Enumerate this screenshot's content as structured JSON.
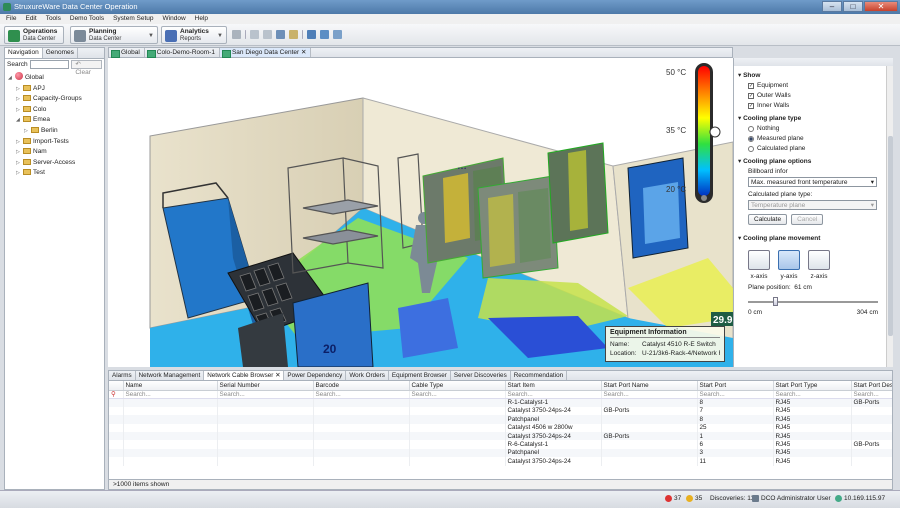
{
  "window": {
    "title": "StruxureWare Data Center Operation",
    "controls": [
      "–",
      "□",
      "✕"
    ]
  },
  "menu": [
    "File",
    "Edit",
    "Tools",
    "Demo Tools",
    "System Setup",
    "Window",
    "Help"
  ],
  "perspectives": [
    {
      "title": "Operations",
      "subtitle": "Data Center",
      "color": "#2f8f4e"
    },
    {
      "title": "Planning",
      "subtitle": "Data Center",
      "color": "#7b8a99"
    },
    {
      "title": "Analytics",
      "subtitle": "Reports",
      "color": "#4a6fb5"
    }
  ],
  "navigation": {
    "tabs": [
      "Navigation",
      "Genomes"
    ],
    "search_label": "Search",
    "search_value": "",
    "clear_label": "Clear",
    "tree": [
      {
        "label": "Global",
        "level": 0,
        "expanded": true,
        "type": "globe"
      },
      {
        "label": "APJ",
        "level": 1,
        "expanded": false,
        "type": "folder"
      },
      {
        "label": "Capacity-Groups",
        "level": 1,
        "expanded": false,
        "type": "folder"
      },
      {
        "label": "Colo",
        "level": 1,
        "expanded": false,
        "type": "folder"
      },
      {
        "label": "Emea",
        "level": 1,
        "expanded": true,
        "type": "folder"
      },
      {
        "label": "Berlin",
        "level": 2,
        "expanded": false,
        "type": "folder"
      },
      {
        "label": "Import-Tests",
        "level": 1,
        "expanded": false,
        "type": "folder"
      },
      {
        "label": "Nam",
        "level": 1,
        "expanded": false,
        "type": "folder"
      },
      {
        "label": "Server-Access",
        "level": 1,
        "expanded": false,
        "type": "folder"
      },
      {
        "label": "Test",
        "level": 1,
        "expanded": false,
        "type": "folder"
      }
    ]
  },
  "editor_tabs": [
    "Global",
    "Colo-Demo-Room-1",
    "San Diego Data Center"
  ],
  "editor_active": 2,
  "view3d": {
    "legend": {
      "top": "50 °C",
      "mid": "35 °C",
      "bottom": "20 °C"
    },
    "labels": {
      "rack_number": "20",
      "corner_value": "29.9"
    },
    "equipment_info": {
      "heading": "Equipment Information",
      "name_label": "Name:",
      "name_value": "Catalyst 4510 R-E Switch",
      "location_label": "Location:",
      "location_value": "U-21/3k6-Rack-4/Network Row"
    }
  },
  "properties": {
    "show_heading": "Show",
    "show_items": [
      {
        "label": "Equipment",
        "checked": true
      },
      {
        "label": "Outer Walls",
        "checked": true
      },
      {
        "label": "Inner Walls",
        "checked": true
      }
    ],
    "plane_type_heading": "Cooling plane type",
    "plane_types": [
      {
        "label": "Nothing",
        "selected": false
      },
      {
        "label": "Measured plane",
        "selected": true
      },
      {
        "label": "Calculated plane",
        "selected": false
      }
    ],
    "options_heading": "Cooling plane options",
    "billboard_label": "Billboard infor",
    "billboard_value": "Max. measured front temperature",
    "calc_type_label": "Calculated plane type:",
    "calc_type_value": "Temperature plane",
    "calculate_label": "Calculate",
    "cancel_label": "Cancel",
    "movement_heading": "Cooling plane movement",
    "axes": [
      {
        "label": "x-axis",
        "active": false
      },
      {
        "label": "y-axis",
        "active": true
      },
      {
        "label": "z-axis",
        "active": false
      }
    ],
    "plane_position_label": "Plane position:",
    "plane_position_value": "61 cm",
    "plane_position_fraction": 0.2,
    "range_min": "0 cm",
    "range_max": "304 cm"
  },
  "bottom_tabs": [
    "Alarms",
    "Network Management",
    "Network Cable Browser",
    "Power Dependency",
    "Work Orders",
    "Equipment Browser",
    "Server Discoveries",
    "Recommendation"
  ],
  "bottom_active": 2,
  "cable_table": {
    "columns": [
      "",
      "Name",
      "Serial Number",
      "Barcode",
      "Cable Type",
      "Start Item",
      "Start Port Name",
      "Start Port",
      "Start Port Type",
      "Start Port Description"
    ],
    "search_placeholder": "Search...",
    "rows": [
      [
        "",
        "",
        "",
        "",
        "",
        "R-1-Catalyst-1",
        "",
        "8",
        "RJ45",
        "GB-Ports"
      ],
      [
        "",
        "",
        "",
        "",
        "",
        "Catalyst 3750-24ps-24",
        "GB-Ports",
        "7",
        "RJ45",
        ""
      ],
      [
        "",
        "",
        "",
        "",
        "",
        "Patchpanel",
        "",
        "8",
        "RJ45",
        ""
      ],
      [
        "",
        "",
        "",
        "",
        "",
        "Catalyst 4506 w 2800w",
        "",
        "25",
        "RJ45",
        ""
      ],
      [
        "",
        "",
        "",
        "",
        "",
        "Catalyst 3750-24ps-24",
        "GB-Ports",
        "1",
        "RJ45",
        ""
      ],
      [
        "",
        "",
        "",
        "",
        "",
        "R-6-Catalyst-1",
        "",
        "6",
        "RJ45",
        "GB-Ports"
      ],
      [
        "",
        "",
        "",
        "",
        "",
        "Patchpanel",
        "",
        "3",
        "RJ45",
        ""
      ],
      [
        "",
        "",
        "",
        "",
        "",
        "Catalyst 3750-24ps-24",
        "",
        "11",
        "RJ45",
        ""
      ]
    ],
    "footer": ">1000 items shown"
  },
  "status": {
    "critical": "37",
    "warning": "35",
    "discoveries": "Discoveries: 11",
    "user": "DCO Administrator User",
    "ip": "10.169.115.97"
  }
}
